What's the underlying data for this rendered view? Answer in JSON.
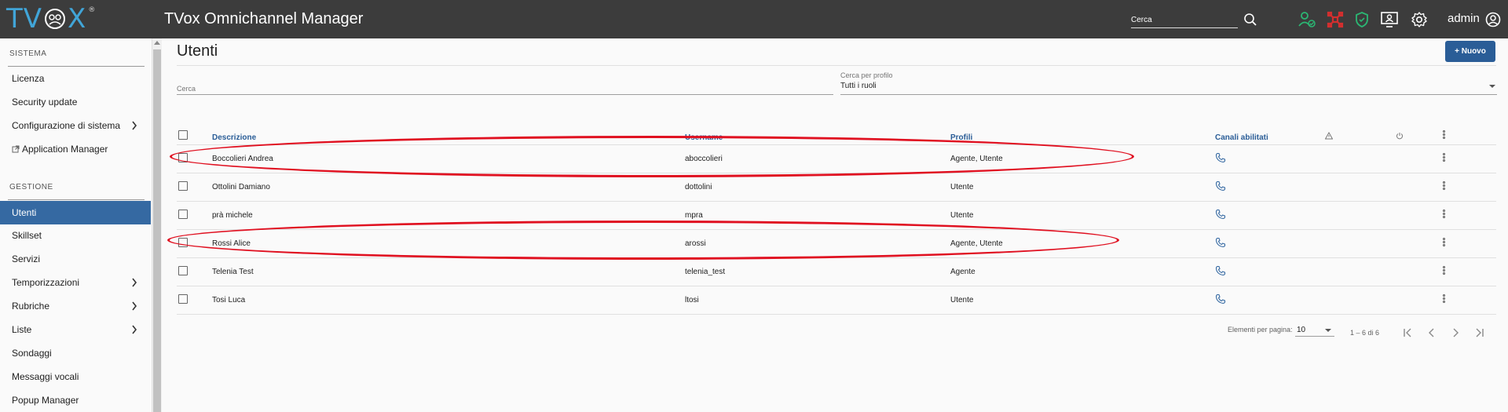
{
  "app": {
    "logo": "TVOX",
    "logo_reg": "®",
    "title": "TVox Omnichannel Manager"
  },
  "topbar": {
    "search_placeholder": "Cerca",
    "user": "admin"
  },
  "colors": {
    "topbar": "#3c3c3c",
    "accent": "#2a5d97",
    "active_nav": "#3569a2",
    "ok_green": "#2bb673",
    "alert_red": "#d32f2f",
    "annotation": "#e01020"
  },
  "sidebar": {
    "section_system": "SISTEMA",
    "system_items": [
      {
        "label": "Licenza"
      },
      {
        "label": "Security update"
      },
      {
        "label": "Configurazione di sistema"
      },
      {
        "label": "Application Manager"
      }
    ],
    "section_management": "GESTIONE",
    "management_items": [
      {
        "label": "Utenti"
      },
      {
        "label": "Skillset"
      },
      {
        "label": "Servizi"
      },
      {
        "label": "Temporizzazioni"
      },
      {
        "label": "Rubriche"
      },
      {
        "label": "Liste"
      },
      {
        "label": "Sondaggi"
      },
      {
        "label": "Messaggi vocali"
      },
      {
        "label": "Popup Manager"
      }
    ]
  },
  "main": {
    "title": "Utenti",
    "new_button": "+ Nuovo",
    "search_label": "Cerca",
    "profile_filter_label": "Cerca per profilo",
    "profile_filter_value": "Tutti i ruoli"
  },
  "table": {
    "columns": {
      "description": "Descrizione",
      "username": "Username",
      "profiles": "Profili",
      "channels": "Canali abilitati"
    },
    "rows": [
      {
        "description": "Boccolieri Andrea",
        "username": "aboccolieri",
        "profiles": "Agente, Utente"
      },
      {
        "description": "Ottolini Damiano",
        "username": "dottolini",
        "profiles": "Utente"
      },
      {
        "description": "prà michele",
        "username": "mpra",
        "profiles": "Utente"
      },
      {
        "description": "Rossi Alice",
        "username": "arossi",
        "profiles": "Agente, Utente"
      },
      {
        "description": "Telenia Test",
        "username": "telenia_test",
        "profiles": "Agente"
      },
      {
        "description": "Tosi Luca",
        "username": "ltosi",
        "profiles": "Utente"
      }
    ]
  },
  "paginator": {
    "items_per_page_label": "Elementi per pagina:",
    "items_per_page": "10",
    "range": "1 – 6 di 6"
  }
}
